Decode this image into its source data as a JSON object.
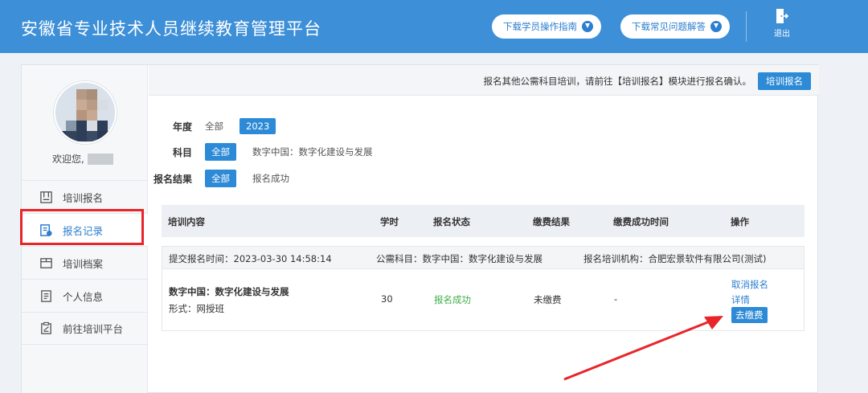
{
  "header": {
    "title": "安徽省专业技术人员继续教育管理平台",
    "guide_btn": "下载学员操作指南",
    "faq_btn": "下载常见问题解答",
    "logout": "退出",
    "bg_color": "#3d8fd8"
  },
  "sidebar": {
    "welcome": "欢迎您,",
    "items": [
      {
        "label": "培训报名",
        "icon": "register-icon"
      },
      {
        "label": "报名记录",
        "icon": "record-icon",
        "active": true
      },
      {
        "label": "培训档案",
        "icon": "archive-icon"
      },
      {
        "label": "个人信息",
        "icon": "profile-icon"
      },
      {
        "label": "前往培训平台",
        "icon": "goto-platform-icon"
      }
    ]
  },
  "topbar": {
    "note": "报名其他公需科目培训，请前往【培训报名】模块进行报名确认。",
    "button": "培训报名"
  },
  "filters": {
    "year_label": "年度",
    "year_all": "全部",
    "year_2023": "2023",
    "subject_label": "科目",
    "subject_all": "全部",
    "subject_opt": "数字中国：数字化建设与发展",
    "result_label": "报名结果",
    "result_all": "全部",
    "result_opt": "报名成功"
  },
  "table": {
    "headers": [
      "培训内容",
      "学时",
      "报名状态",
      "缴费结果",
      "缴费成功时间",
      "操作"
    ],
    "group": {
      "submit_time": "提交报名时间：2023-03-30 14:58:14",
      "subject": "公需科目：数字中国：数字化建设与发展",
      "org": "报名培训机构：合肥宏景软件有限公司(测试)",
      "course": "数字中国：数字化建设与发展",
      "form": "形式：网授班",
      "hours": "30",
      "status": "报名成功",
      "pay_result": "未缴费",
      "pay_time": "-",
      "cancel": "取消报名",
      "detail": "详情",
      "pay": "去缴费"
    }
  },
  "colors": {
    "accent": "#2c8ad6",
    "success": "#3fae49",
    "highlight": "#e8262a"
  }
}
